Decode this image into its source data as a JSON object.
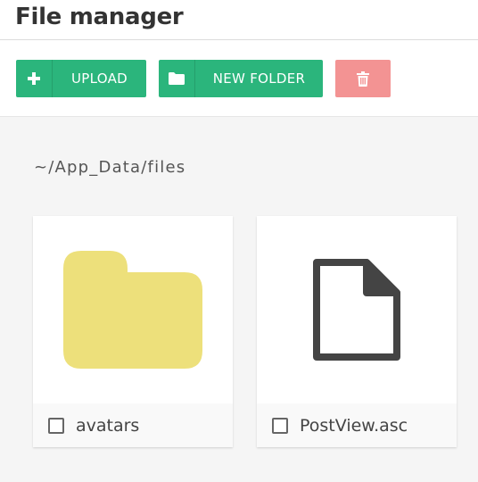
{
  "header": {
    "title": "File manager"
  },
  "toolbar": {
    "upload": {
      "label": "UPLOAD",
      "icon": "plus-icon"
    },
    "new_folder": {
      "label": "NEW FOLDER",
      "icon": "folder-icon"
    },
    "delete": {
      "icon": "trash-icon"
    }
  },
  "path": "~/App_Data/files",
  "items": [
    {
      "name": "avatars",
      "type": "folder",
      "icon": "folder-icon",
      "checked": false
    },
    {
      "name": "PostView.asc",
      "type": "file",
      "icon": "document-icon",
      "checked": false
    }
  ],
  "colors": {
    "accent": "#2bb57c",
    "danger": "#f39393",
    "folder": "#ede07b",
    "file_stroke": "#444444",
    "background": "#f5f5f5"
  }
}
